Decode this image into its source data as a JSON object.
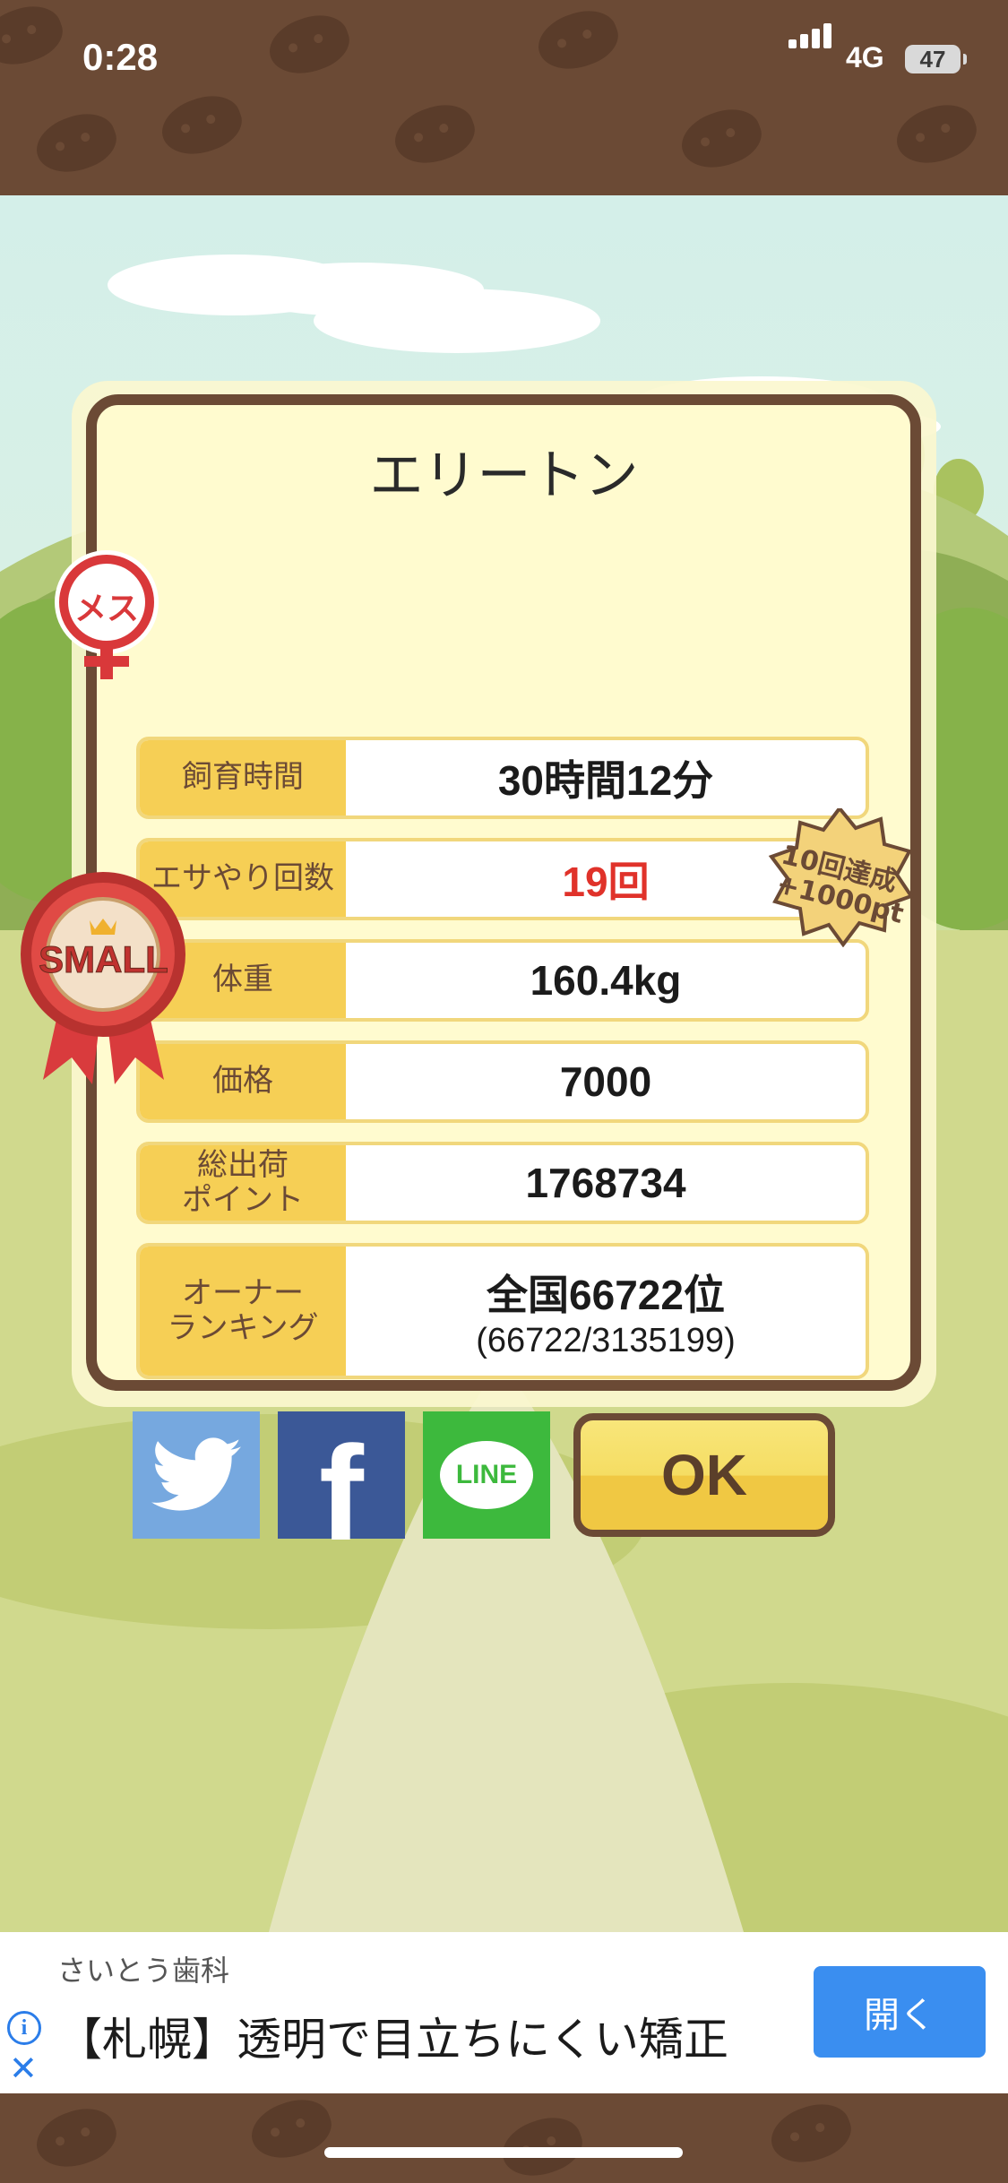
{
  "status_bar": {
    "time": "0:28",
    "network": "4G",
    "battery": "47"
  },
  "pig": {
    "name": "エリートン",
    "gender_badge": "メス",
    "size_badge": "SMALL"
  },
  "stats": [
    {
      "label": "飼育時間",
      "value": "30時間12分"
    },
    {
      "label": "エサやり回数",
      "value": "19回"
    },
    {
      "label": "体重",
      "value": "160.4kg"
    },
    {
      "label": "価格",
      "value": "7000"
    },
    {
      "label": "総出荷\nポイント",
      "value": "1768734"
    },
    {
      "label": "オーナー\nランキング",
      "value": "全国66722位",
      "sub": "(66722/3135199)"
    }
  ],
  "achievement_badge": {
    "line1": "10回達成",
    "line2": "+1000pt"
  },
  "share": {
    "line": "LINE"
  },
  "ok_button": "OK",
  "ad": {
    "brand": "さいとう歯科",
    "text": "【札幌】透明で目立ちにくい矯正",
    "button": "開く"
  },
  "colors": {
    "frame": "#6b4a35",
    "label_bg": "#f6cf55",
    "highlight_value": "#e0322a",
    "ad_button": "#3a8ef0"
  }
}
